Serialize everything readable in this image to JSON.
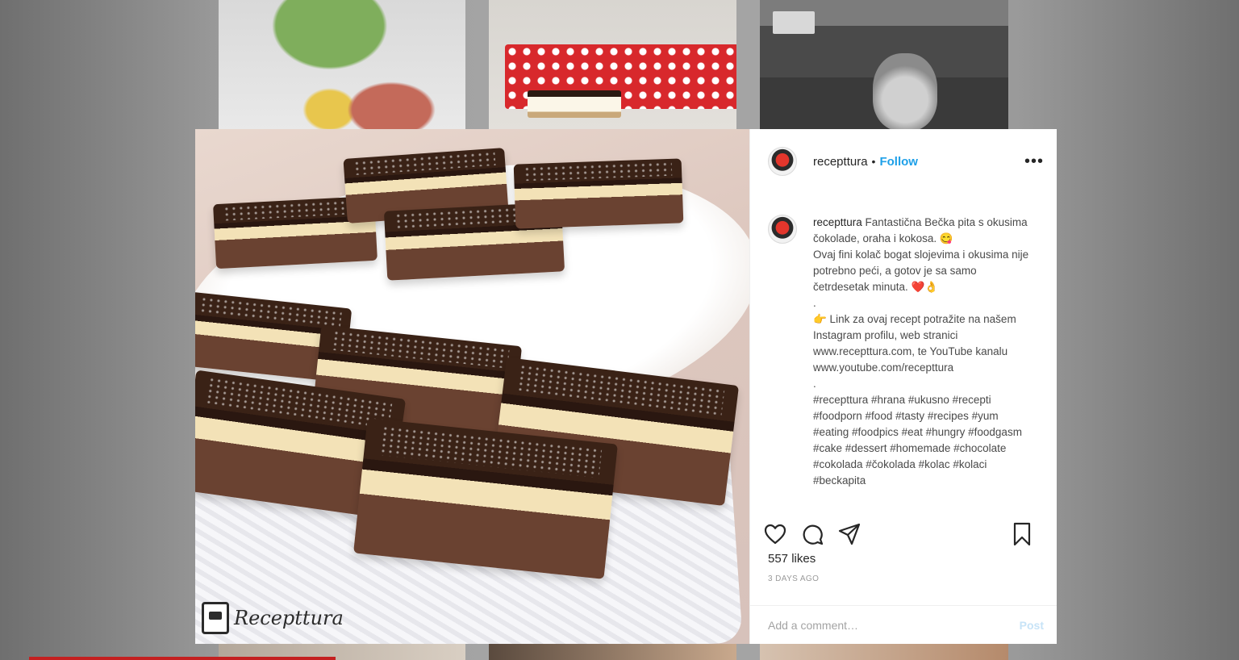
{
  "post": {
    "username": "recepttura",
    "separator": "•",
    "follow_label": "Follow",
    "more_label": "•••",
    "caption_user": "recepttura",
    "caption_text": " Fantastična Bečka pita s okusima čokolade, oraha i kokosa. 😋\nOvaj fini kolač bogat slojevima i okusima nije potrebno peći, a gotov je sa samo četrdesetak minuta. ❤️👌\n.\n👉 Link za ovaj recept potražite na našem Instagram profilu, web stranici www.recepttura.com, te YouTube kanalu www.youtube.com/recepttura\n.\n#recepttura #hrana #ukusno #recepti #foodporn #food #tasty #recipes #yum #eating #foodpics #eat #hungry #foodgasm #cake #dessert #homemade #chocolate #cokolada #čokolada #kolac #kolaci #beckapita",
    "likes": "557 likes",
    "time_ago": "3 DAYS AGO",
    "comment_placeholder": "Add a comment…",
    "post_label": "Post"
  },
  "photo": {
    "logo_text": "Recepttura"
  },
  "icons": {
    "like": "heart-icon",
    "comment": "comment-icon",
    "share": "paper-plane-icon",
    "save": "bookmark-icon"
  },
  "colors": {
    "follow": "#1ea0e8",
    "text": "#262626",
    "muted": "#9a9a9a"
  }
}
